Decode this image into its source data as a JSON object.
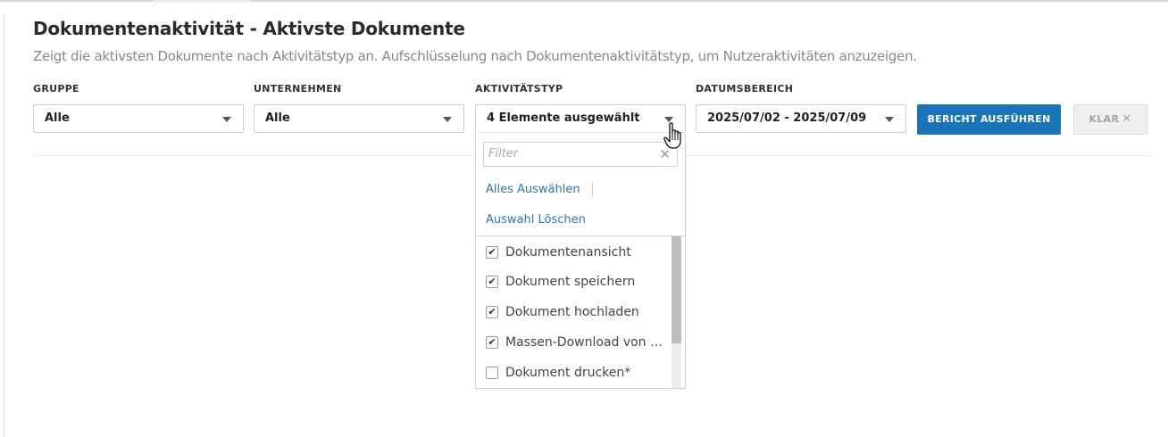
{
  "page": {
    "title": "Dokumentenaktivität - Aktivste Dokumente",
    "subtitle": "Zeigt die aktivsten Dokumente nach Aktivitätstyp an. Aufschlüsselung nach Dokumentenaktivitätstyp, um Nutzeraktivitäten anzuzeigen."
  },
  "filters": {
    "gruppe": {
      "label": "GRUPPE",
      "value": "Alle"
    },
    "unternehmen": {
      "label": "UNTERNEHMEN",
      "value": "Alle"
    },
    "aktivitaetstyp": {
      "label": "AKTIVITÄTSTYP",
      "value": "4 Elemente ausgewählt"
    },
    "datumsbereich": {
      "label": "DATUMSBEREICH",
      "value": "2025/07/02 - 2025/07/09"
    }
  },
  "buttons": {
    "run_report": "BERICHT AUSFÜHREN",
    "clear": "KLAR",
    "clear_icon": "✕"
  },
  "dropdown": {
    "filter_placeholder": "Filter",
    "filter_clear_icon": "✕",
    "select_all": "Alles Auswählen",
    "clear_selection": "Auswahl Löschen",
    "options": [
      {
        "label": "Dokumentenansicht",
        "checked": true
      },
      {
        "label": "Dokument speichern",
        "checked": true
      },
      {
        "label": "Dokument hochladen",
        "checked": true
      },
      {
        "label": "Massen-Download von …",
        "checked": true
      },
      {
        "label": "Dokument drucken*",
        "checked": false
      }
    ]
  },
  "icons": {
    "caret": "caret-down-icon",
    "cursor": "hand-pointer-icon",
    "check": "✔"
  },
  "colors": {
    "primary": "#1a74b9",
    "link": "#2a76b6",
    "muted_text": "#888888"
  }
}
